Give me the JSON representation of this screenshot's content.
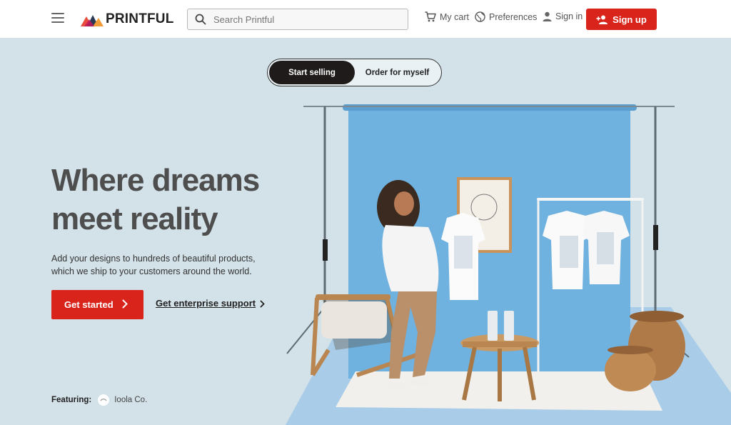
{
  "header": {
    "logo_text": "PRINTFUL",
    "search_placeholder": "Search Printful",
    "cart_label": "My cart",
    "preferences_label": "Preferences",
    "signin_label": "Sign in",
    "signup_label": "Sign up"
  },
  "toggle": {
    "active_label": "Start selling",
    "inactive_label": "Order for myself"
  },
  "hero": {
    "title_line1": "Where dreams",
    "title_line2": "meet reality",
    "subtitle": "Add your designs to hundreds of beautiful products, which we ship to your customers around the world.",
    "cta_label": "Get started",
    "enterprise_label": "Get enterprise support"
  },
  "featuring": {
    "label": "Featuring:",
    "brand": "Ioola Co."
  },
  "colors": {
    "brand_red": "#d9241c",
    "hero_bg": "#d3e1e8",
    "backdrop_blue": "#6fb1df"
  },
  "icons": [
    "hamburger-icon",
    "printful-logo",
    "search-icon",
    "cart-icon",
    "globe-icon",
    "user-icon",
    "add-user-icon",
    "chevron-right-icon"
  ]
}
